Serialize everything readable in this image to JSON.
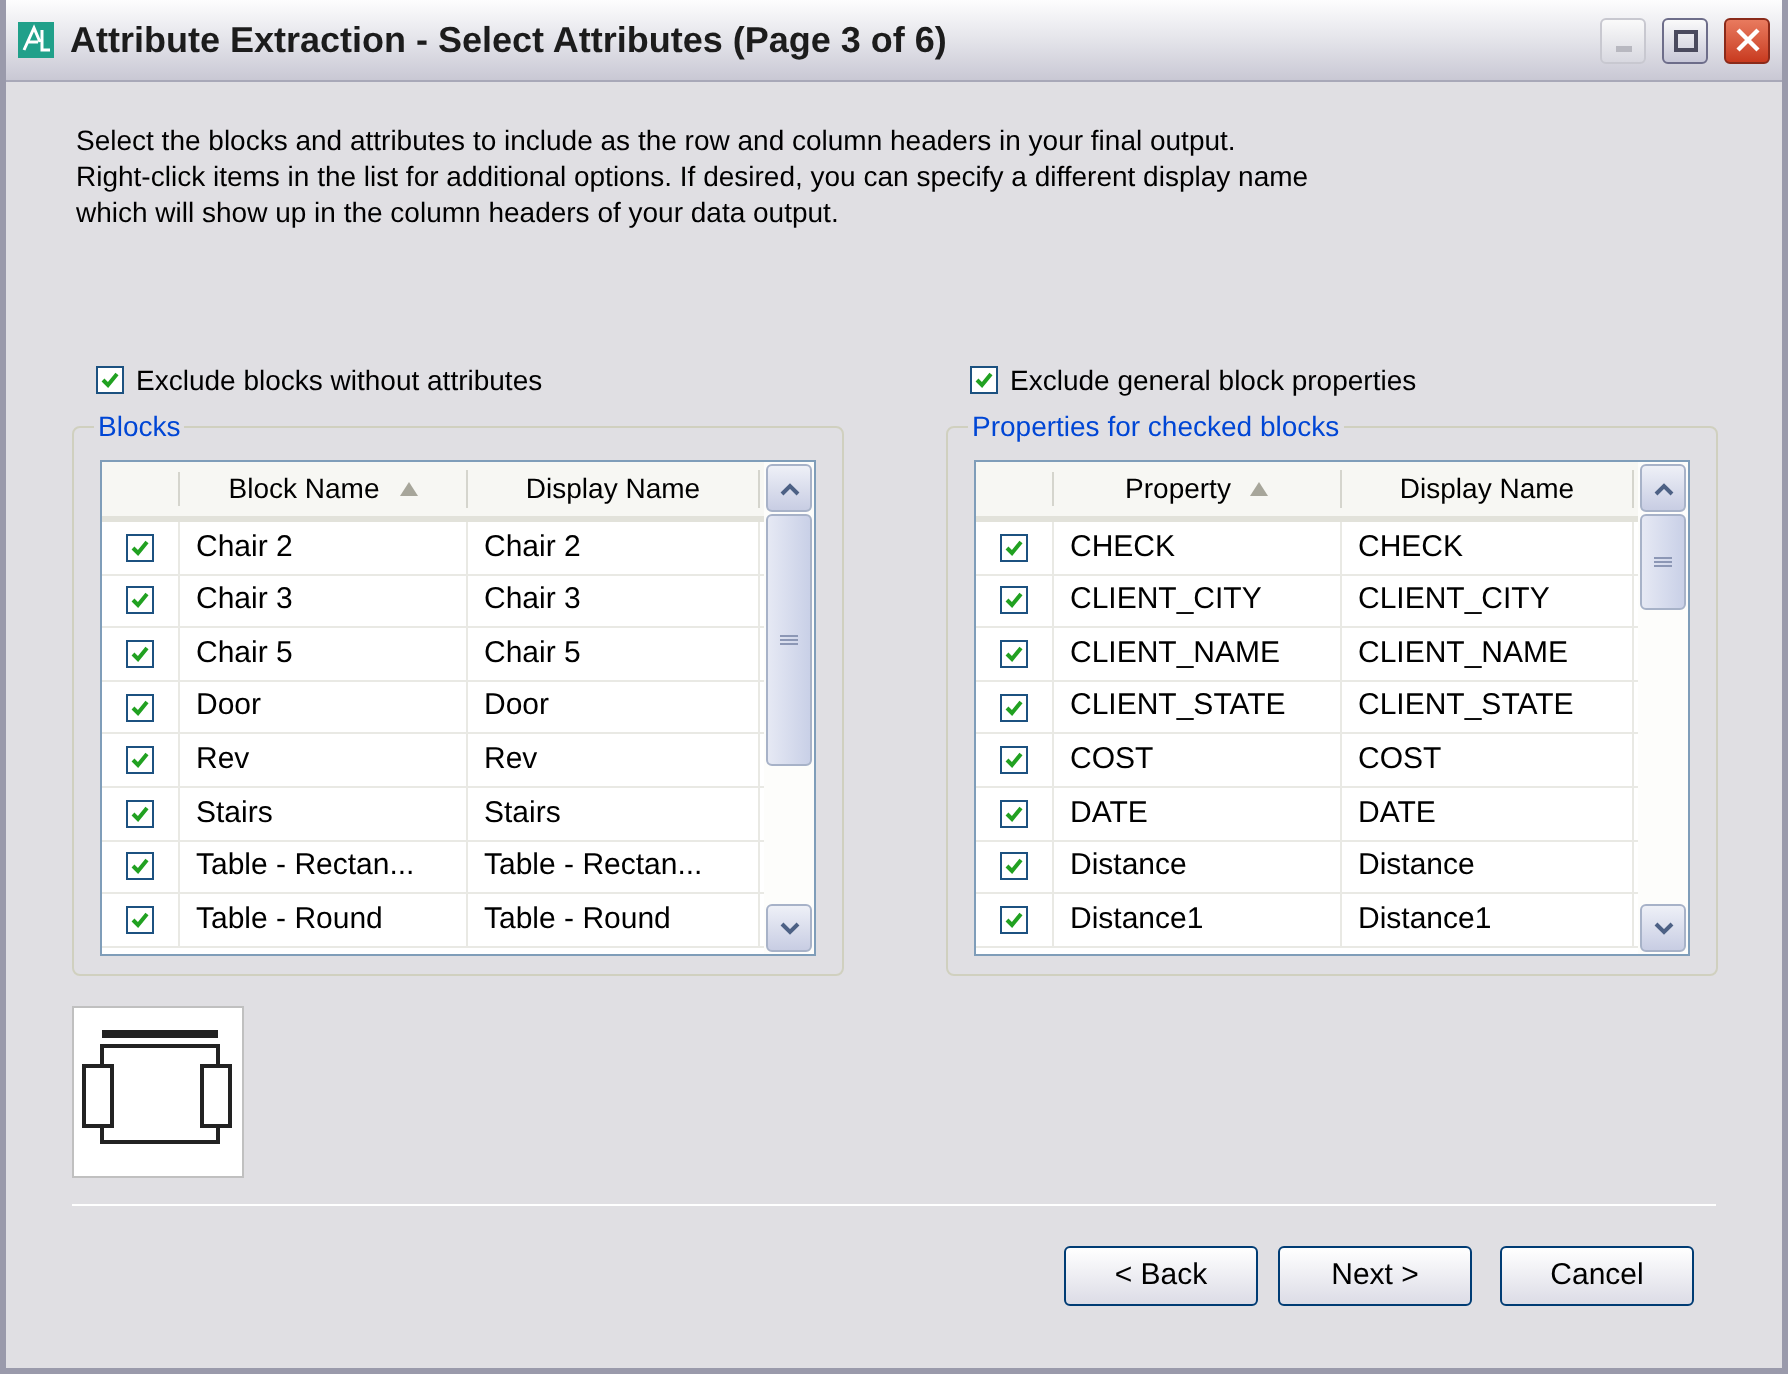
{
  "window": {
    "title": "Attribute Extraction - Select Attributes (Page 3 of 6)"
  },
  "description": [
    "Select the blocks and attributes to include as the row and column headers in your final output.",
    "Right-click items in the list for additional options. If desired, you can specify a different display name",
    "which will show up in the column headers of your data output."
  ],
  "panels": [
    {
      "option": {
        "label": "Exclude blocks without attributes",
        "checked": true
      },
      "group_title": "Blocks",
      "columns": [
        {
          "label": "Block Name",
          "sorted": true
        },
        {
          "label": "Display Name",
          "sorted": false
        }
      ],
      "rows": [
        {
          "checked": true,
          "name": "Chair 2",
          "display_name": "Chair 2"
        },
        {
          "checked": true,
          "name": "Chair 3",
          "display_name": "Chair 3"
        },
        {
          "checked": true,
          "name": "Chair 5",
          "display_name": "Chair 5"
        },
        {
          "checked": true,
          "name": "Door",
          "display_name": "Door"
        },
        {
          "checked": true,
          "name": "Rev",
          "display_name": "Rev"
        },
        {
          "checked": true,
          "name": "Stairs",
          "display_name": "Stairs"
        },
        {
          "checked": true,
          "name": "Table - Rectan...",
          "display_name": "Table - Rectan..."
        },
        {
          "checked": true,
          "name": "Table - Round",
          "display_name": "Table - Round"
        }
      ]
    },
    {
      "option": {
        "label": "Exclude general block properties",
        "checked": true
      },
      "group_title": "Properties for checked blocks",
      "columns": [
        {
          "label": "Property",
          "sorted": true
        },
        {
          "label": "Display Name",
          "sorted": false
        }
      ],
      "rows": [
        {
          "checked": true,
          "name": "CHECK",
          "display_name": "CHECK"
        },
        {
          "checked": true,
          "name": "CLIENT_CITY",
          "display_name": "CLIENT_CITY"
        },
        {
          "checked": true,
          "name": "CLIENT_NAME",
          "display_name": "CLIENT_NAME"
        },
        {
          "checked": true,
          "name": "CLIENT_STATE",
          "display_name": "CLIENT_STATE"
        },
        {
          "checked": true,
          "name": "COST",
          "display_name": "COST"
        },
        {
          "checked": true,
          "name": "DATE",
          "display_name": "DATE"
        },
        {
          "checked": true,
          "name": "Distance",
          "display_name": "Distance"
        },
        {
          "checked": true,
          "name": "Distance1",
          "display_name": "Distance1"
        }
      ]
    }
  ],
  "buttons": [
    "< Back",
    "Next >",
    "Cancel"
  ]
}
